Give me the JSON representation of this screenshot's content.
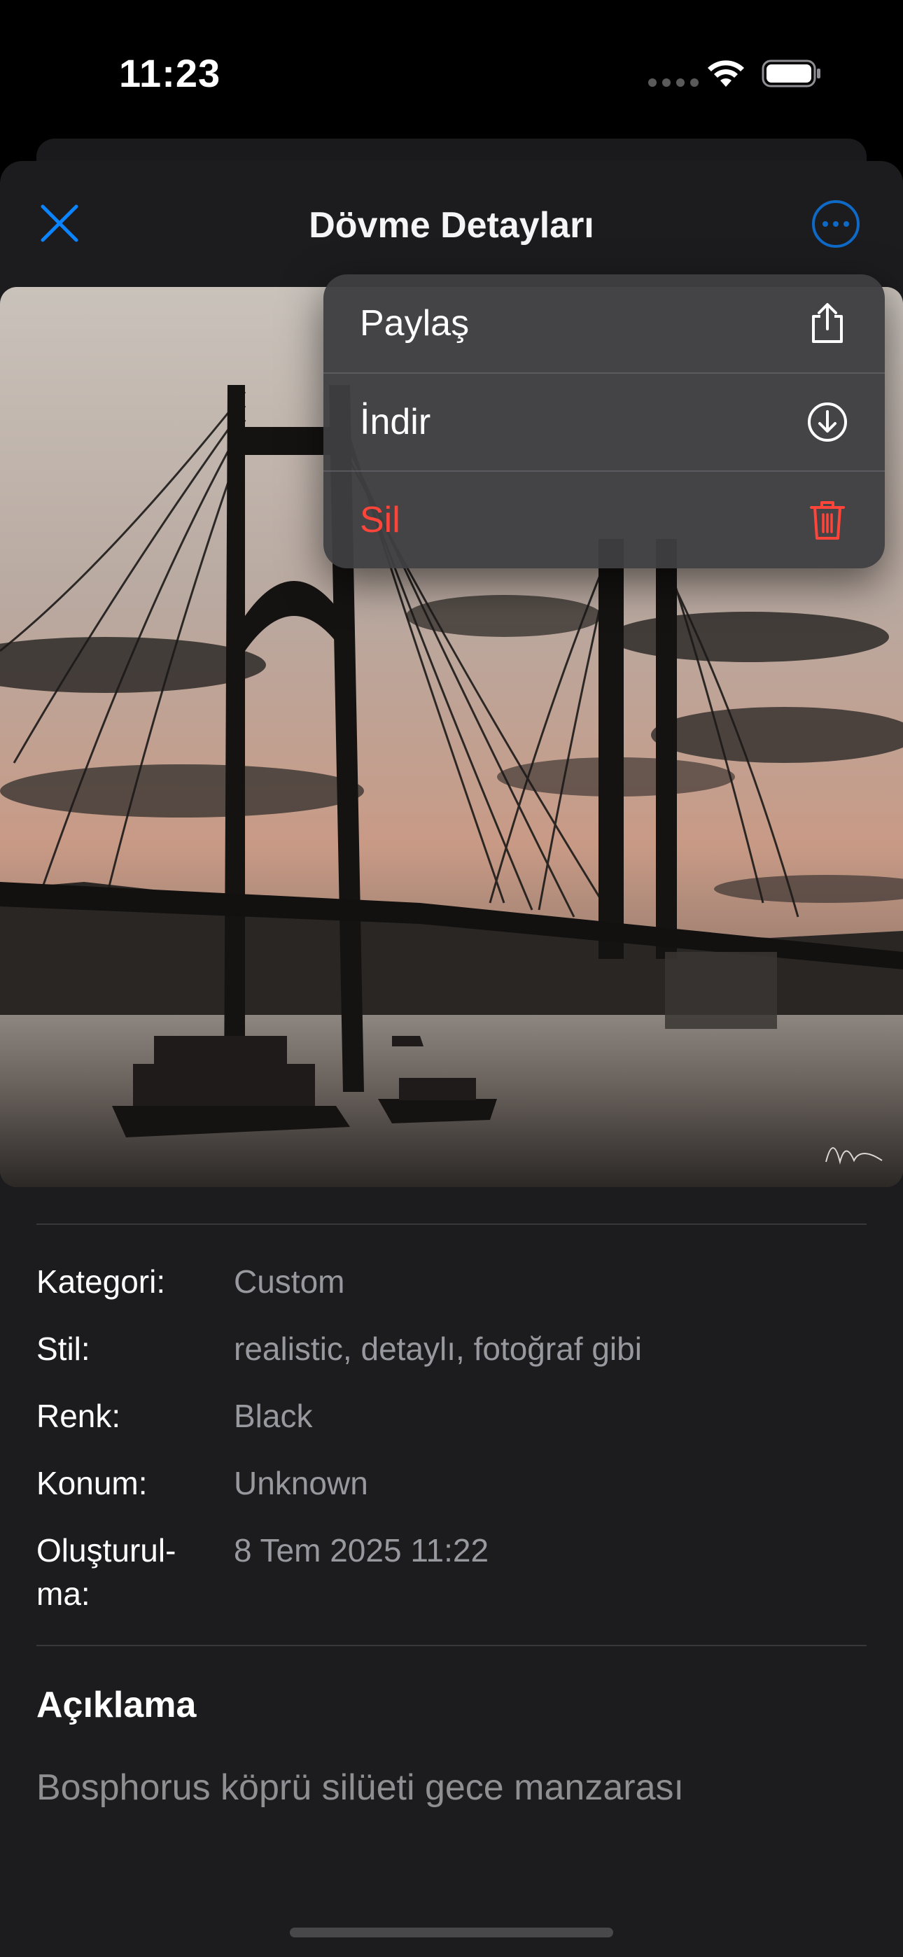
{
  "status_bar": {
    "time": "11:23",
    "icons": [
      "cellular-dots-icon",
      "wifi-icon",
      "battery-icon"
    ]
  },
  "nav": {
    "title": "Dövme Detayları",
    "close_icon": "close-x-icon",
    "more_icon": "ellipsis-circle-icon"
  },
  "context_menu": {
    "items": [
      {
        "label": "Paylaş",
        "icon": "share-icon",
        "destructive": false
      },
      {
        "label": "İndir",
        "icon": "download-circle-icon",
        "destructive": false
      },
      {
        "label": "Sil",
        "icon": "trash-icon",
        "destructive": true
      }
    ]
  },
  "image": {
    "subject": "Bosphorus bridge silhouette at dusk with ferry boats",
    "icon": "tattoo-artwork-image"
  },
  "details": {
    "rows": [
      {
        "label": "Kategori:",
        "value": "Custom"
      },
      {
        "label": "Stil:",
        "value": "realistic, detaylı, fotoğraf gibi"
      },
      {
        "label": "Renk:",
        "value": "Black"
      },
      {
        "label": "Konum:",
        "value": "Unknown"
      },
      {
        "label": "Oluşturul-\nma:",
        "label_line1": "Oluşturul-",
        "label_line2": "ma:",
        "value": "8 Tem 2025 11:22"
      }
    ]
  },
  "description": {
    "title": "Açıklama",
    "text": "Bosphorus köprü silüeti gece manzarası"
  },
  "colors": {
    "accent": "#0A84FF",
    "destructive": "#FF453A",
    "sheet_background": "#1C1C1E",
    "menu_background": "#3E3E42",
    "secondary_text": "#98989F"
  }
}
